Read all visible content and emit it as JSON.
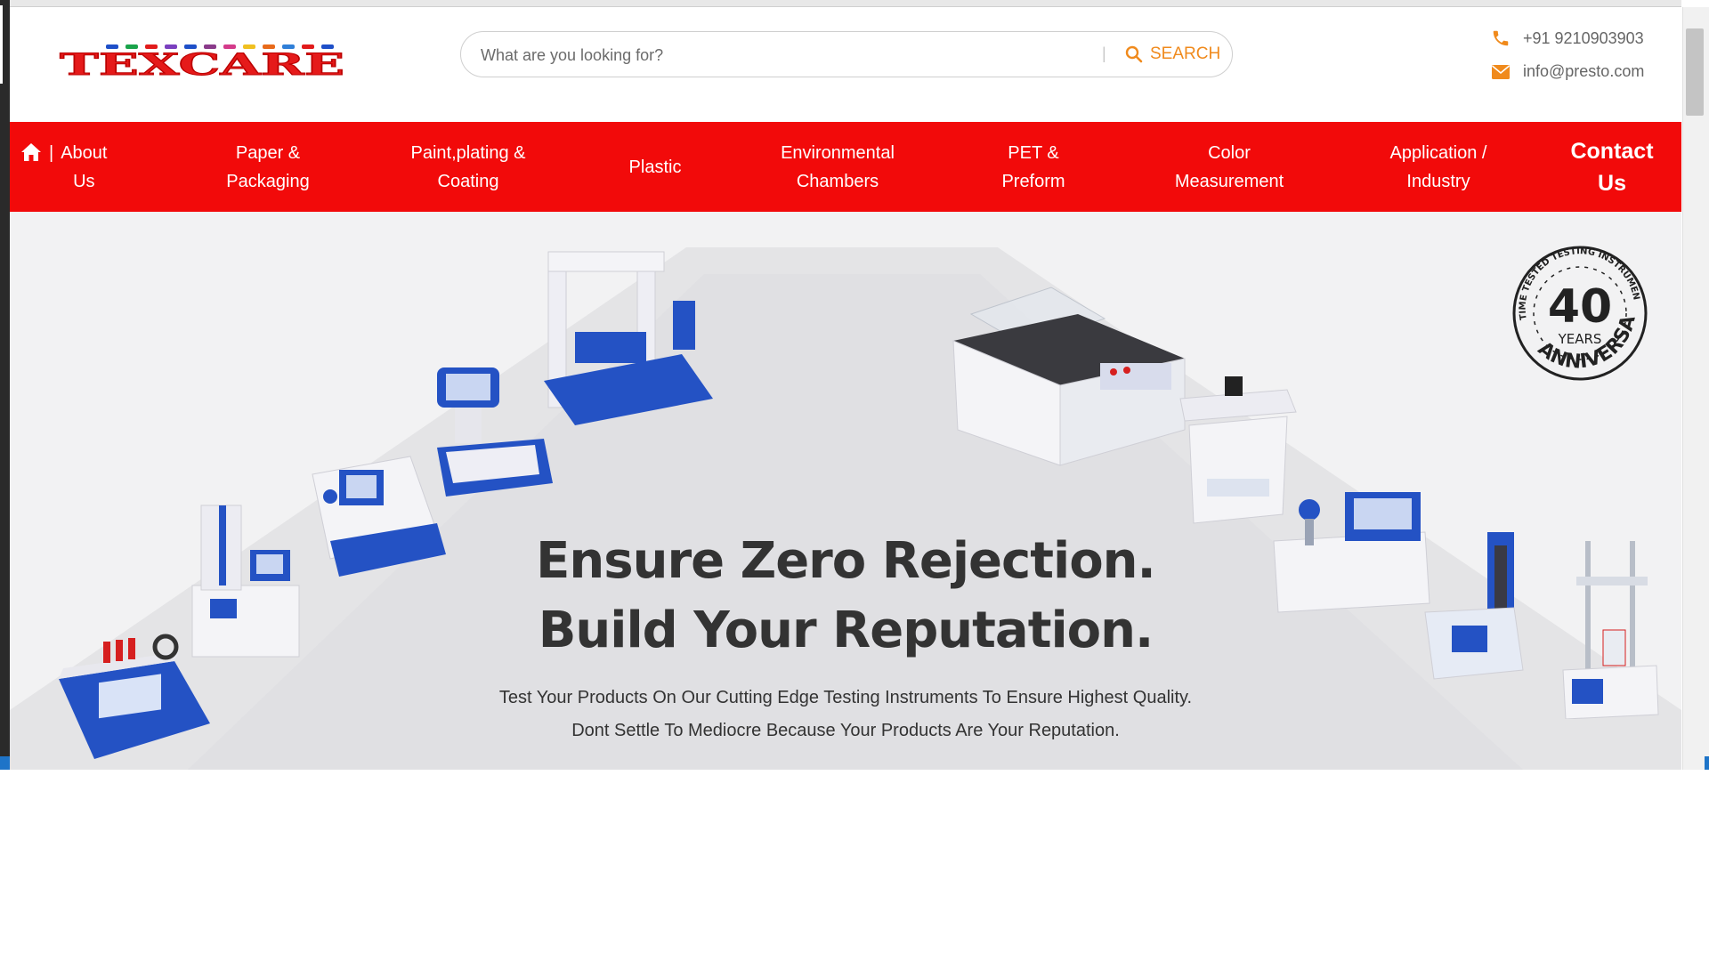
{
  "header": {
    "logo_text": "TEXCARE",
    "search": {
      "placeholder": "What are you looking for?",
      "divider": "|",
      "button_label": "SEARCH"
    },
    "contact": {
      "phone": "+91 9210903903",
      "email": "info@presto.com"
    }
  },
  "nav": {
    "separator": "|",
    "items": [
      {
        "lines": [
          "About",
          "Us"
        ]
      },
      {
        "lines": [
          "Paper &",
          "Packaging"
        ]
      },
      {
        "lines": [
          "Paint,plating &",
          "Coating"
        ]
      },
      {
        "lines": [
          "Plastic"
        ]
      },
      {
        "lines": [
          "Environmental",
          "Chambers"
        ]
      },
      {
        "lines": [
          "PET &",
          "Preform"
        ]
      },
      {
        "lines": [
          "Color",
          "Measurement"
        ]
      },
      {
        "lines": [
          "Application /",
          "Industry"
        ]
      },
      {
        "lines": [
          "Contact",
          "Us"
        ]
      }
    ]
  },
  "hero": {
    "headline_1": "Ensure Zero Rejection.",
    "headline_2": "Build Your Reputation.",
    "subtext_1": "Test Your Products On Our Cutting Edge Testing Instruments To Ensure Highest Quality.",
    "subtext_2": "Dont Settle To Mediocre Because Your Products Are Your Reputation.",
    "badge": {
      "number": "40",
      "years": "YEARS",
      "arc_top": "TIME TESTED TESTING INSTRUMENTS",
      "arc_bottom": "ANNIVERSARY"
    }
  },
  "colors": {
    "nav_bg": "#f20a0a",
    "accent_orange": "#f08a1c",
    "hero_bg": "#f2f2f3",
    "machine_blue": "#1f4fbf"
  }
}
